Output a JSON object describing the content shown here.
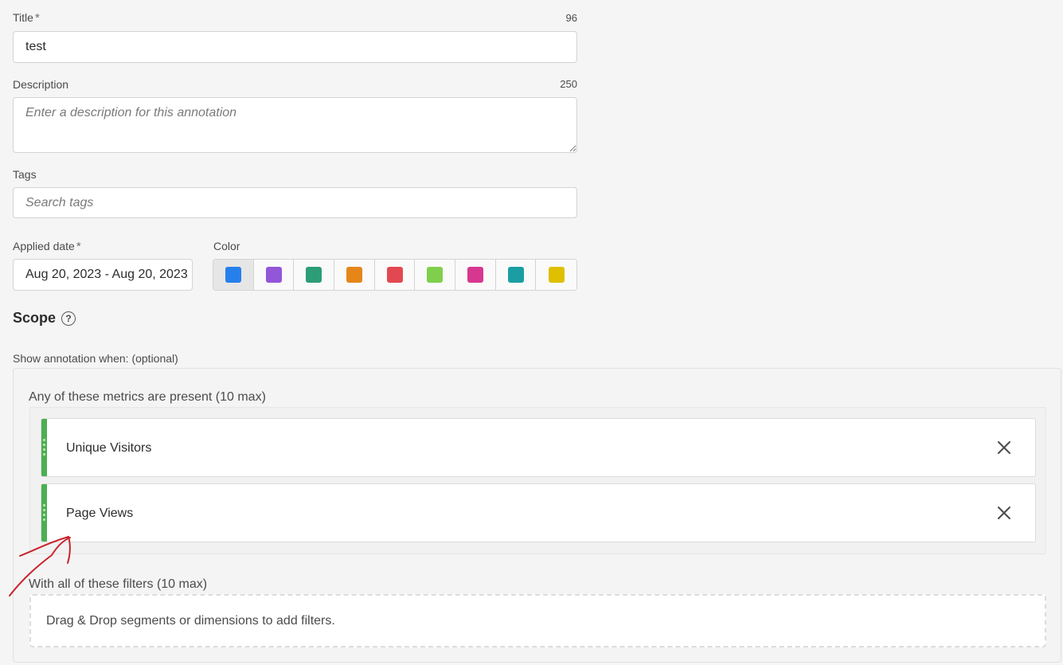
{
  "form": {
    "title_label": "Title",
    "required_mark": "*",
    "title_counter": "96",
    "title_value": "test",
    "description_label": "Description",
    "description_counter": "250",
    "description_placeholder": "Enter a description for this annotation",
    "tags_label": "Tags",
    "tags_placeholder": "Search tags",
    "applied_date_label": "Applied date",
    "applied_date_value": "Aug 20, 2023 - Aug 20, 2023",
    "color_label": "Color",
    "colors": [
      "#2680eb",
      "#9256d9",
      "#2d9d78",
      "#e68619",
      "#e34850",
      "#7fcf4c",
      "#d83790",
      "#1b9ea3",
      "#dfbf00"
    ],
    "selected_color_index": 0
  },
  "scope": {
    "title": "Scope",
    "help_glyph": "?",
    "show_when_label": "Show annotation when: (optional)",
    "metrics_label": "Any of these metrics are present (10 max)",
    "metrics": [
      {
        "label": "Unique Visitors"
      },
      {
        "label": "Page Views"
      }
    ],
    "filters_label": "With all of these filters (10 max)",
    "filters_drop_text": "Drag & Drop segments or dimensions to add filters."
  },
  "annotation": {
    "arrow_color": "#c8232c"
  }
}
